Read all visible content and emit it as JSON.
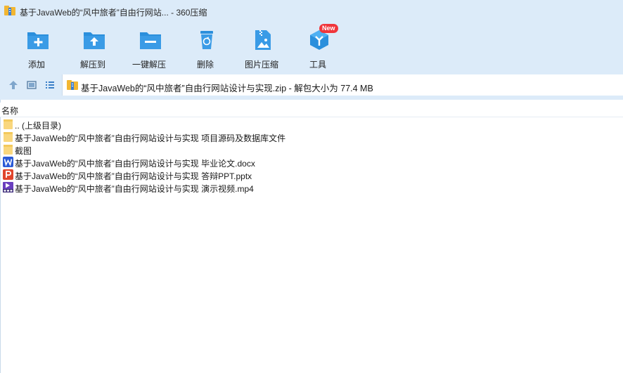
{
  "window": {
    "title": "基于JavaWeb的“风中旅者”自由行网站... - 360压缩"
  },
  "toolbar": {
    "items": [
      {
        "label": "添加",
        "icon": "add-icon"
      },
      {
        "label": "解压到",
        "icon": "extract-to-icon"
      },
      {
        "label": "一键解压",
        "icon": "one-click-extract-icon"
      },
      {
        "label": "删除",
        "icon": "delete-icon"
      },
      {
        "label": "图片压缩",
        "icon": "image-compress-icon"
      },
      {
        "label": "工具",
        "icon": "tools-icon",
        "badge": "New"
      }
    ]
  },
  "address": {
    "path": "基于JavaWeb的“风中旅者”自由行网站设计与实现.zip - 解包大小为 77.4 MB"
  },
  "list": {
    "column_name": "名称",
    "files": [
      {
        "name": ".. (上级目录)",
        "type": "folder"
      },
      {
        "name": "基于JavaWeb的“风中旅者”自由行网站设计与实现 项目源码及数据库文件",
        "type": "folder"
      },
      {
        "name": "截图",
        "type": "folder"
      },
      {
        "name": "基于JavaWeb的“风中旅者”自由行网站设计与实现 毕业论文.docx",
        "type": "word"
      },
      {
        "name": "基于JavaWeb的“风中旅者”自由行网站设计与实现 答辩PPT.pptx",
        "type": "ppt"
      },
      {
        "name": "基于JavaWeb的“风中旅者”自由行网站设计与实现 演示视频.mp4",
        "type": "mp4"
      }
    ]
  },
  "colors": {
    "chrome_bg": "#dcebf9",
    "icon_blue": "#2b8fdc",
    "folder_yellow": "#f9d77e",
    "badge_red": "#f0363c"
  }
}
